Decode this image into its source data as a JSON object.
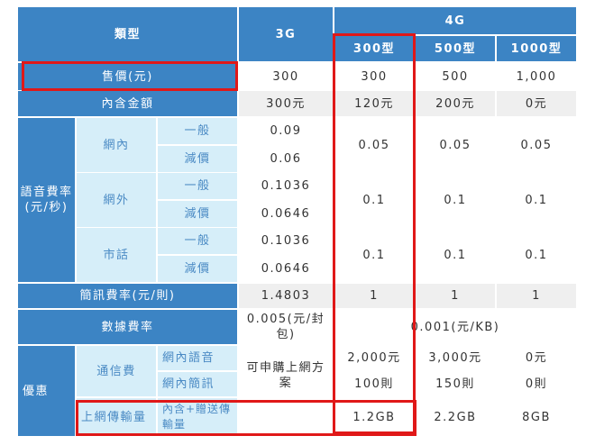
{
  "header": {
    "type_label": "類型",
    "col_3g": "3G",
    "col_4g": "4G",
    "plans": [
      "300型",
      "500型",
      "1000型"
    ]
  },
  "rows": {
    "price_label": "售價(元)",
    "price_values": [
      "300",
      "300",
      "500",
      "1,000"
    ],
    "included_label": "內含金額",
    "included_values": [
      "300元",
      "120元",
      "200元",
      "0元"
    ],
    "voice_label": "語音費率\n(元/秒)",
    "voice_groups": [
      {
        "name": "網內",
        "general": "一般",
        "discount": "減價",
        "g3_general": "0.09",
        "g3_discount": "0.06",
        "g4": [
          "0.05",
          "0.05",
          "0.05"
        ]
      },
      {
        "name": "網外",
        "general": "一般",
        "discount": "減價",
        "g3_general": "0.1036",
        "g3_discount": "0.0646",
        "g4": [
          "0.1",
          "0.1",
          "0.1"
        ]
      },
      {
        "name": "市話",
        "general": "一般",
        "discount": "減價",
        "g3_general": "0.1036",
        "g3_discount": "0.0646",
        "g4": [
          "0.1",
          "0.1",
          "0.1"
        ]
      }
    ],
    "sms_label": "簡訊費率(元/則)",
    "sms_values": [
      "1.4803",
      "1",
      "1",
      "1"
    ],
    "data_label": "數據費率",
    "data_3g": "0.005(元/封包)",
    "data_4g": "0.001(元/KB)",
    "promo_label": "優惠",
    "bundle_label": "通信費",
    "onnet_voice_label": "網內語音",
    "onnet_voice_values": [
      "2,000元",
      "3,000元",
      "0元"
    ],
    "onnet_sms_label": "網內簡訊",
    "onnet_sms_values": [
      "100則",
      "150則",
      "0則"
    ],
    "promo_3g_note": "可申購上網方案",
    "data_volume_label": "上網傳輸量",
    "data_volume_sub": "內含+贈送傳輸量",
    "data_volume_values": [
      "1.2GB",
      "2.2GB",
      "8GB"
    ]
  },
  "highlights": [
    "price-row-highlight",
    "300-plan-column-highlight",
    "data-volume-highlight"
  ],
  "colors": {
    "header": "#3c84c4",
    "subheader": "#d6eef9",
    "highlight": "#e01818"
  }
}
